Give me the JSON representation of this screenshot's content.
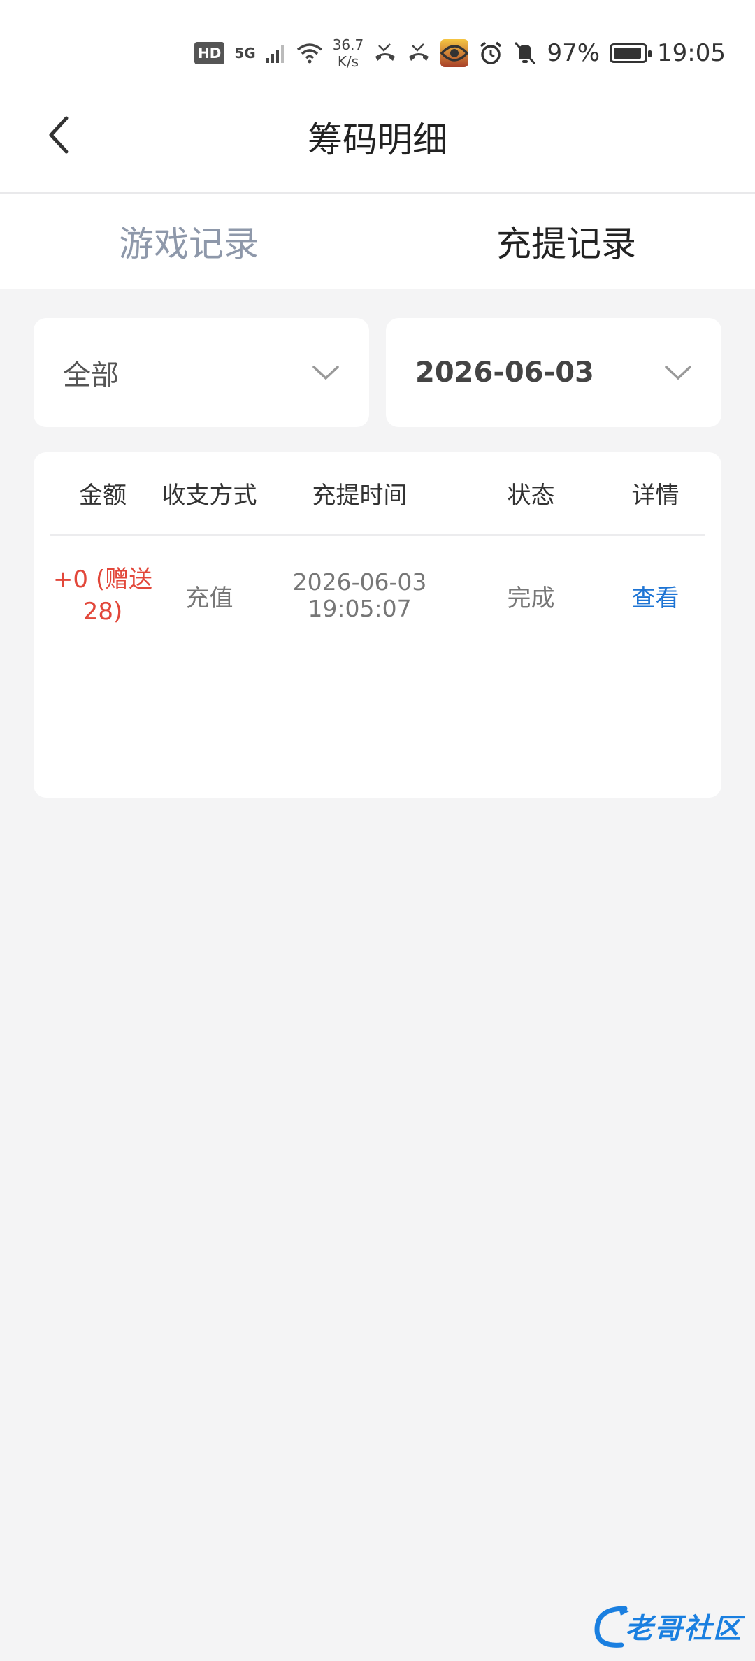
{
  "status_bar": {
    "time": "19:05",
    "battery": "97%",
    "battery_level": 0.97,
    "network": "5G",
    "hd": "HD",
    "net_speed_value": "36.7",
    "net_speed_unit": "K/s",
    "icons": [
      "hd-icon",
      "signal-icon",
      "wifi-icon",
      "missed-call-icon",
      "missed-call-icon",
      "app-avatar-icon",
      "eye-icon",
      "alarm-icon",
      "mute-icon",
      "battery-icon"
    ]
  },
  "header": {
    "title": "筹码明细",
    "back_icon": "chevron-left-icon"
  },
  "tabs": [
    {
      "label": "游戏记录",
      "active": false
    },
    {
      "label": "充提记录",
      "active": true
    }
  ],
  "filters": {
    "type": {
      "value": "全部"
    },
    "date": {
      "value": "2026-06-03"
    }
  },
  "table": {
    "columns": [
      "金额",
      "收支方式",
      "充提时间",
      "状态",
      "详情"
    ],
    "rows": [
      {
        "amount_line1": "+0 (赠送",
        "amount_line2": "28)",
        "method": "充值",
        "date": "2026-06-03",
        "time": "19:05:07",
        "status": "完成",
        "detail": "查看"
      }
    ]
  },
  "watermark": {
    "text": "老哥社区"
  },
  "colors": {
    "accent_blue": "#1d74d4",
    "amount_red": "#e2473a",
    "inactive_tab": "#8e98aa",
    "background": "#f4f4f5"
  }
}
